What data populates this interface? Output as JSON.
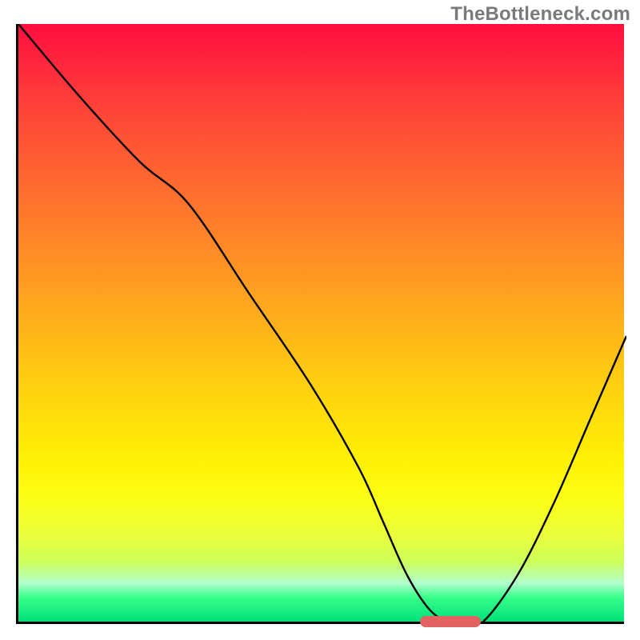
{
  "watermark": "TheBottleneck.com",
  "chart_data": {
    "type": "line",
    "title": "",
    "xlabel": "",
    "ylabel": "",
    "xlim": [
      0,
      100
    ],
    "ylim": [
      0,
      100
    ],
    "x": [
      0,
      10,
      20,
      28,
      38,
      48,
      56,
      60,
      64,
      68,
      72,
      76,
      82,
      88,
      94,
      100
    ],
    "values": [
      100,
      88,
      77,
      70,
      55,
      40,
      26,
      17,
      8,
      2,
      0,
      0,
      8,
      20,
      34,
      48
    ],
    "optimal_range": {
      "x_start": 66,
      "x_end": 76,
      "y": 0
    },
    "background_gradient": {
      "stops": [
        {
          "pos": 0,
          "color": "#ff0e3d"
        },
        {
          "pos": 0.07,
          "color": "#ff283d"
        },
        {
          "pos": 0.15,
          "color": "#ff4638"
        },
        {
          "pos": 0.26,
          "color": "#ff6830"
        },
        {
          "pos": 0.38,
          "color": "#ff8b26"
        },
        {
          "pos": 0.5,
          "color": "#ffb11a"
        },
        {
          "pos": 0.62,
          "color": "#ffd40e"
        },
        {
          "pos": 0.73,
          "color": "#fff104"
        },
        {
          "pos": 0.8,
          "color": "#fbff17"
        },
        {
          "pos": 0.86,
          "color": "#e8ff3e"
        },
        {
          "pos": 0.9,
          "color": "#ccff59"
        },
        {
          "pos": 0.935,
          "color": "#b3ffcc"
        },
        {
          "pos": 0.96,
          "color": "#36ff8a"
        },
        {
          "pos": 1.0,
          "color": "#00e079"
        }
      ]
    }
  }
}
